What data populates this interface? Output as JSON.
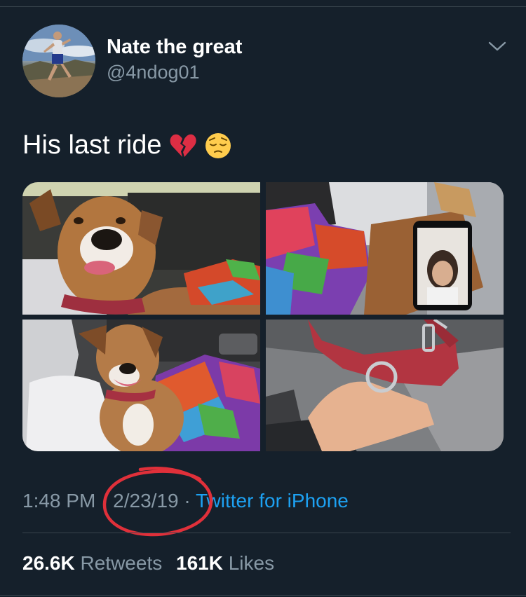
{
  "author": {
    "display_name": "Nate the great",
    "handle": "@4ndog01"
  },
  "tweet": {
    "text": "His last ride",
    "emojis": [
      "broken-heart",
      "pensive-face"
    ],
    "photos": [
      "dog-in-car-seat",
      "blanket-and-phone-facetime",
      "dog-smiling-on-blanket",
      "hand-holding-red-collar"
    ]
  },
  "meta": {
    "time": "1:48 PM",
    "sep1": " · ",
    "date": "2/23/19",
    "sep2": " · ",
    "source": "Twitter for iPhone"
  },
  "stats": {
    "retweets_count": "26.6K",
    "retweets_label": "Retweets",
    "likes_count": "161K",
    "likes_label": "Likes"
  },
  "colors": {
    "background": "#15202b",
    "secondary_text": "#8899a6",
    "link": "#1da1f2",
    "annotation_circle": "#e0303a"
  }
}
